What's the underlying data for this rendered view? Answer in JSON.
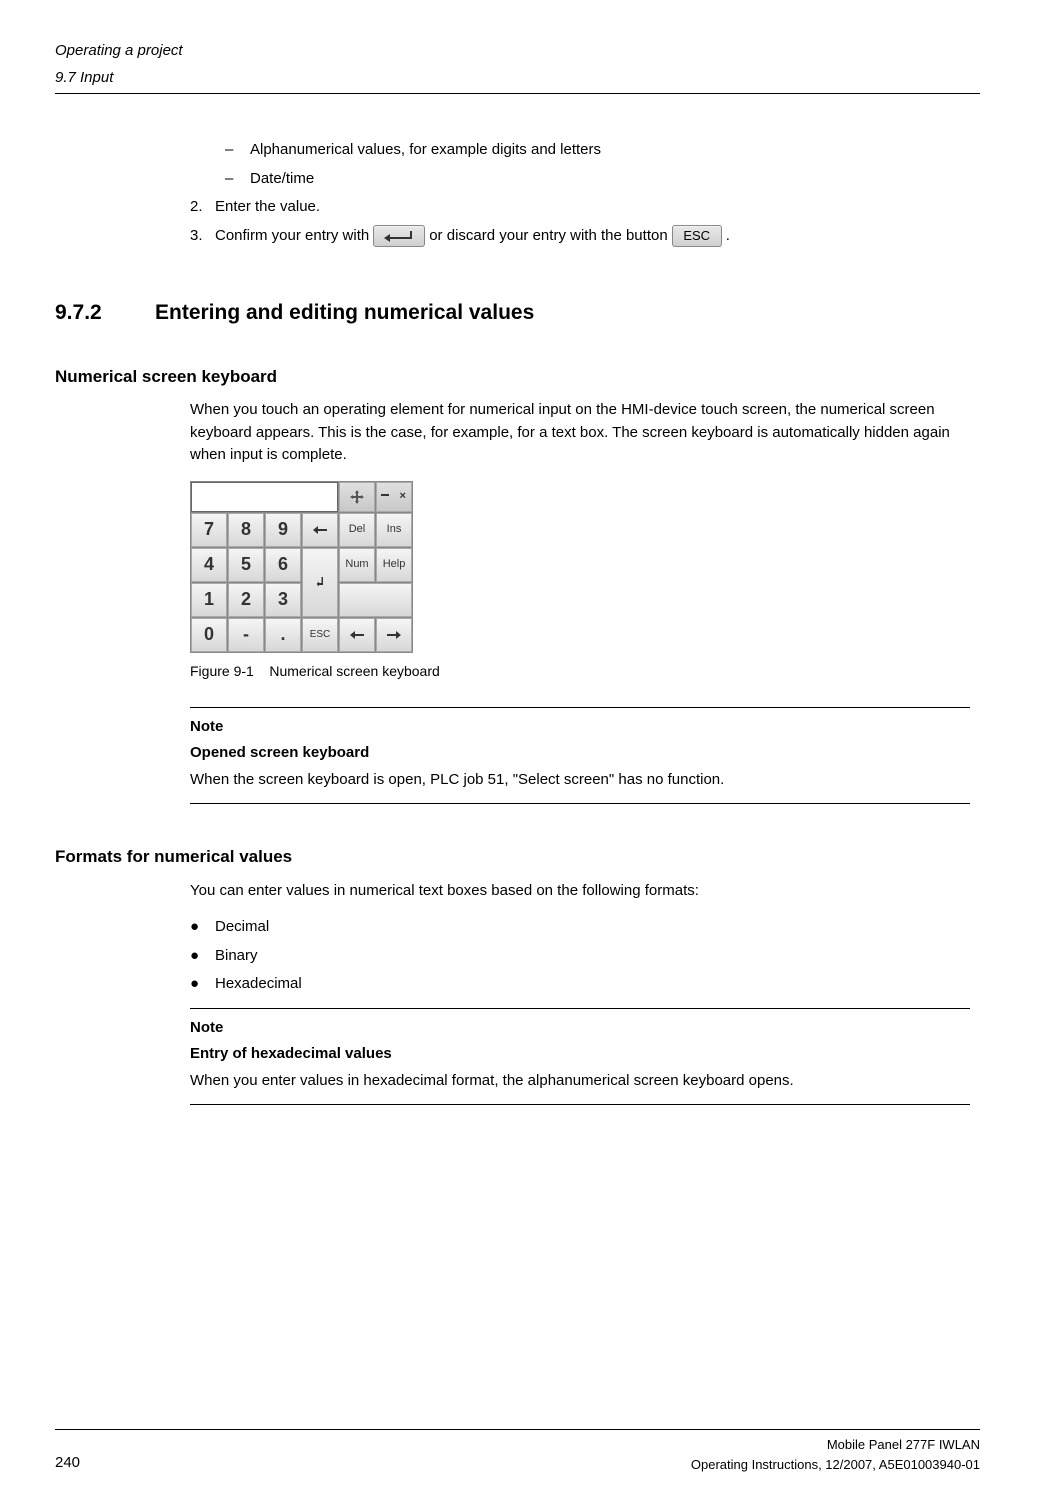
{
  "header": {
    "title": "Operating a project",
    "subtitle": "9.7 Input"
  },
  "list1": {
    "item1": "Alphanumerical values, for example digits and letters",
    "item2": "Date/time"
  },
  "step2": {
    "num": "2.",
    "text": "Enter the value."
  },
  "step3": {
    "num": "3.",
    "text_before": "Confirm your entry with",
    "text_middle": "or discard your entry with the button",
    "esc_label": "ESC",
    "text_after": "."
  },
  "section": {
    "number": "9.7.2",
    "title": "Entering and editing numerical values"
  },
  "subheading1": "Numerical screen keyboard",
  "para1": "When you touch an operating element for numerical input on the HMI-device touch screen, the numerical screen keyboard appears. This is the case, for example, for a text box. The screen keyboard is automatically hidden again when input is complete.",
  "keypad": {
    "r1": [
      "7",
      "8",
      "9"
    ],
    "r2": [
      "4",
      "5",
      "6"
    ],
    "r3": [
      "1",
      "2",
      "3"
    ],
    "r4": [
      "0",
      "-",
      "."
    ],
    "del": "Del",
    "ins": "Ins",
    "num": "Num",
    "help": "Help",
    "esc": "ESC"
  },
  "figure_caption_label": "Figure 9-1",
  "figure_caption_text": "Numerical screen keyboard",
  "note1": {
    "title": "Note",
    "subtitle": "Opened screen keyboard",
    "text": "When the screen keyboard is open, PLC job 51, \"Select screen\" has no function."
  },
  "subheading2": "Formats for numerical values",
  "para2": "You can enter values in numerical text boxes based on the following formats:",
  "formats": {
    "f1": "Decimal",
    "f2": "Binary",
    "f3": "Hexadecimal"
  },
  "note2": {
    "title": "Note",
    "subtitle": "Entry of hexadecimal values",
    "text": "When you enter values in hexadecimal format, the alphanumerical screen keyboard opens."
  },
  "footer": {
    "page": "240",
    "right1": "Mobile Panel 277F IWLAN",
    "right2": "Operating Instructions, 12/2007, A5E01003940-01"
  }
}
